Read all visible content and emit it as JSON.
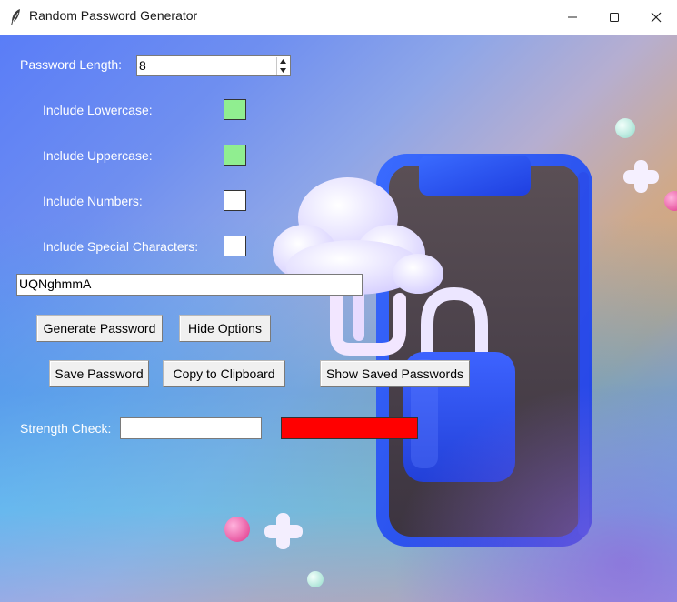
{
  "window": {
    "title": "Random Password Generator",
    "app_icon": "feather-icon",
    "controls": [
      "minimize-icon",
      "maximize-icon",
      "close-icon"
    ]
  },
  "form": {
    "length_label": "Password Length:",
    "length_value": "8",
    "options": [
      {
        "label": "Include Lowercase:",
        "checked": true
      },
      {
        "label": "Include Uppercase:",
        "checked": true
      },
      {
        "label": "Include Numbers:",
        "checked": false
      },
      {
        "label": "Include Special Characters:",
        "checked": false
      }
    ],
    "password_output": "UQNghmmA",
    "buttons": {
      "generate": "Generate Password",
      "hide_options": "Hide Options",
      "save": "Save Password",
      "copy": "Copy to Clipboard",
      "show_saved": "Show Saved Passwords"
    },
    "strength_label": "Strength Check:",
    "strength_value": "",
    "strength_color": "#ff0000"
  },
  "colors": {
    "checked": "#90ee90",
    "unchecked": "#ffffff",
    "label_text": "#ffffff"
  }
}
